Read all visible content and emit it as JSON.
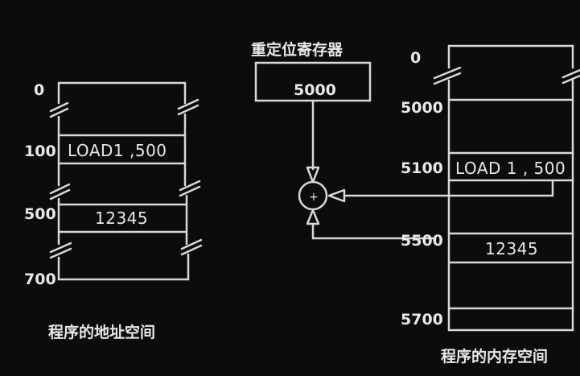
{
  "register": {
    "title": "重定位寄存器",
    "value": "5000"
  },
  "adder": {
    "symbol": "+"
  },
  "program_space": {
    "caption": "程序的地址空间",
    "addresses": [
      "0",
      "100",
      "500",
      "700"
    ],
    "instruction": "LOAD1 ,500",
    "data_value": "12345"
  },
  "memory_space": {
    "caption": "程序的内存空间",
    "addresses": [
      "0",
      "5000",
      "5100",
      "5500",
      "5700"
    ],
    "instruction": "LOAD 1 , 500",
    "data_value": "12345"
  }
}
